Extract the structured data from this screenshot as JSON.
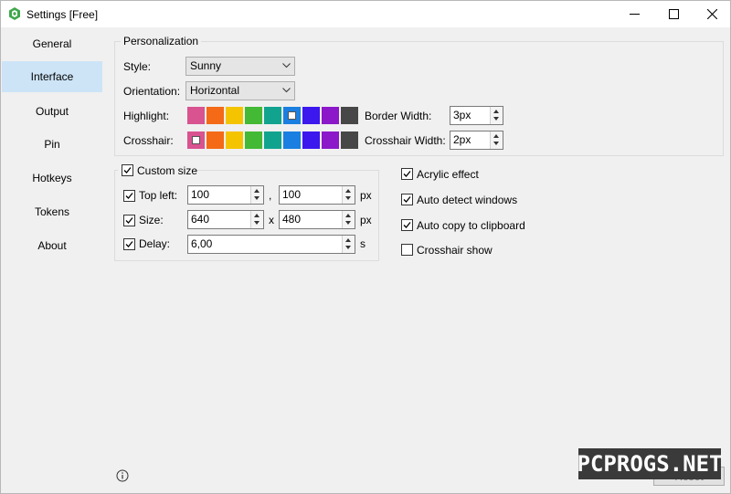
{
  "window": {
    "title": "Settings [Free]"
  },
  "sidebar": {
    "items": [
      {
        "label": "General"
      },
      {
        "label": "Interface",
        "active": true
      },
      {
        "label": "Output"
      },
      {
        "label": "Pin"
      },
      {
        "label": "Hotkeys"
      },
      {
        "label": "Tokens"
      },
      {
        "label": "About"
      }
    ]
  },
  "personalization": {
    "title": "Personalization",
    "style_label": "Style:",
    "style_value": "Sunny",
    "orientation_label": "Orientation:",
    "orientation_value": "Horizontal",
    "highlight_label": "Highlight:",
    "crosshair_label": "Crosshair:",
    "border_width_label": "Border Width:",
    "border_width_value": "3px",
    "crosshair_width_label": "Crosshair Width:",
    "crosshair_width_value": "2px",
    "palette": [
      "#d8538f",
      "#f46a16",
      "#f5c400",
      "#43b935",
      "#12a38f",
      "#1a7fe0",
      "#3c17ee",
      "#8b18c9",
      "#474747"
    ],
    "highlight_selected_index": 5,
    "crosshair_selected_index": 0
  },
  "custom_size": {
    "label": "Custom size",
    "checked": true,
    "top_left_label": "Top left:",
    "top_left_x": "100",
    "top_left_sep": ",",
    "top_left_y": "100",
    "top_left_unit": "px",
    "size_label": "Size:",
    "size_w": "640",
    "size_sep": "x",
    "size_h": "480",
    "size_unit": "px",
    "delay_label": "Delay:",
    "delay_value": "6,00",
    "delay_unit": "s"
  },
  "options": {
    "acrylic_label": "Acrylic effect",
    "acrylic": true,
    "auto_detect_label": "Auto detect windows",
    "auto_detect": true,
    "auto_copy_label": "Auto copy to clipboard",
    "auto_copy": true,
    "crosshair_show_label": "Crosshair show",
    "crosshair_show": false
  },
  "footer": {
    "reset_label": "Reset"
  },
  "watermark": {
    "text": "PCPROGS.NET"
  },
  "icons": [
    "app-icon",
    "minimize-icon",
    "maximize-icon",
    "close-icon",
    "chevron-down-icon",
    "info-icon",
    "check-icon"
  ]
}
